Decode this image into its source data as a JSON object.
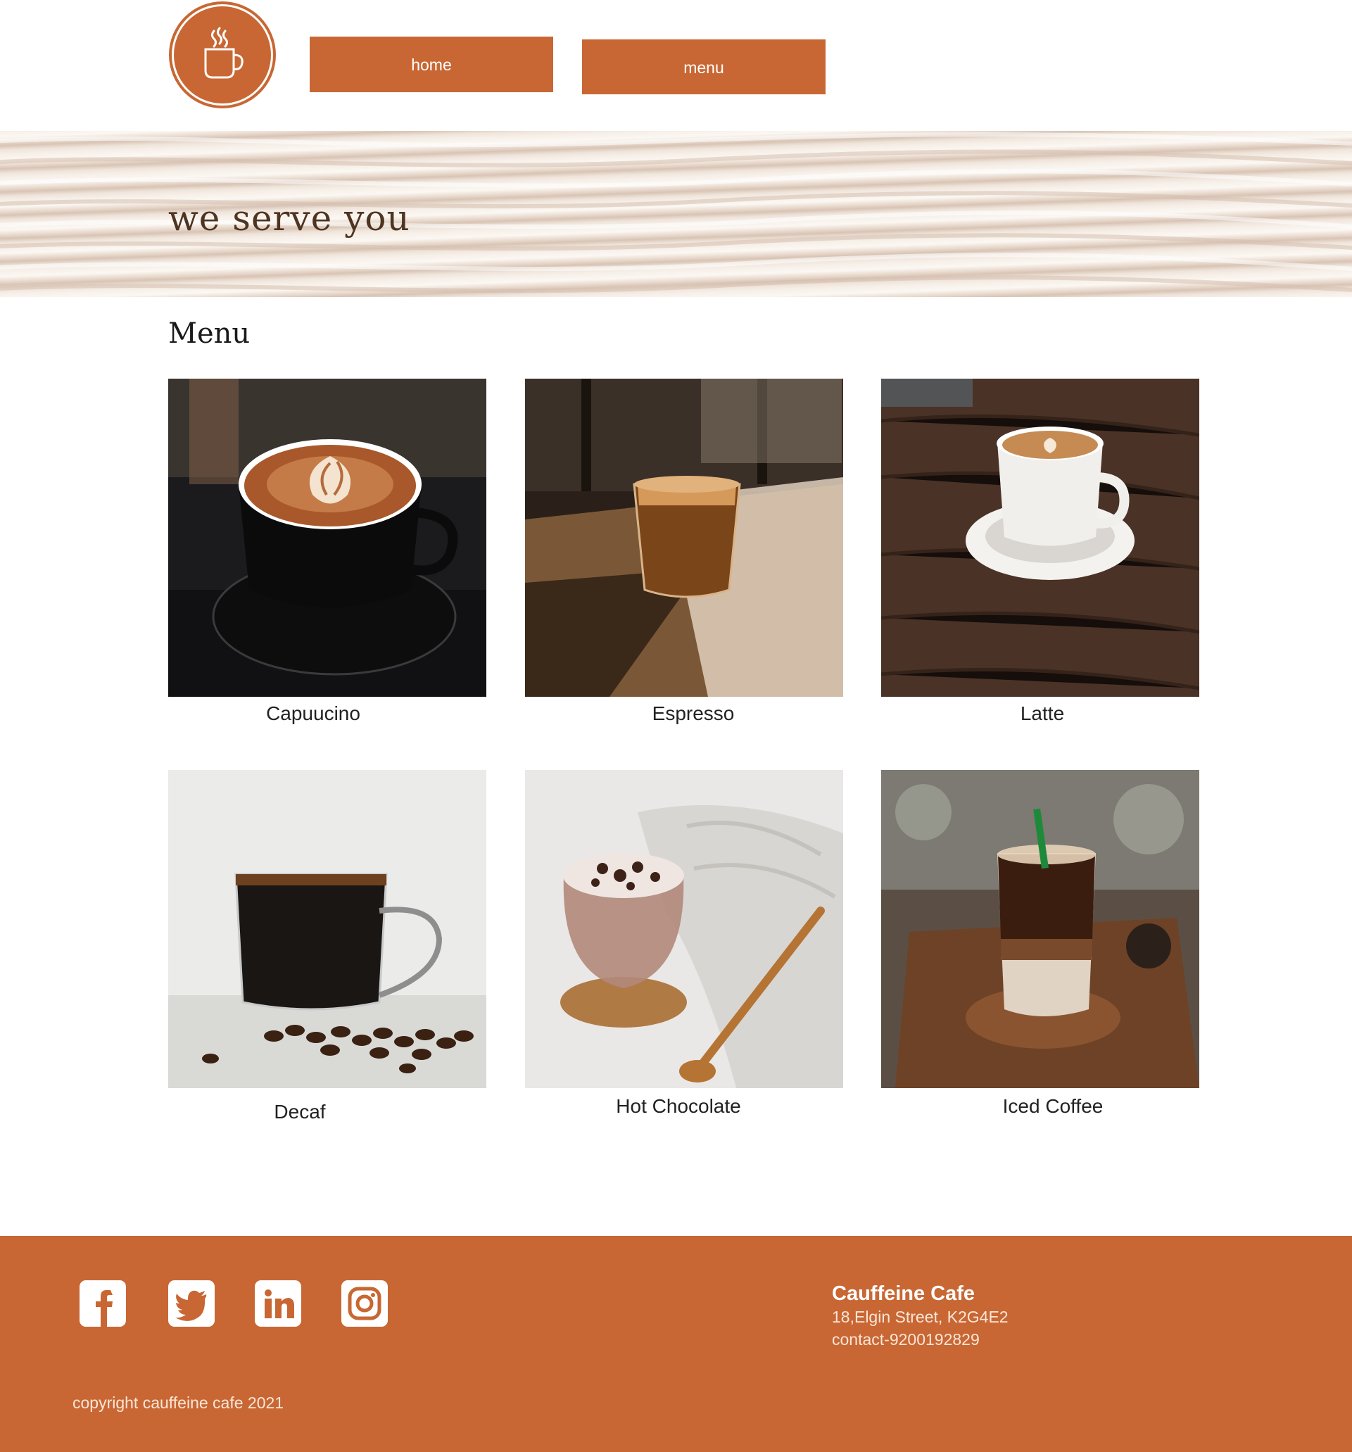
{
  "header": {
    "logo_icon": "coffee-cup-icon",
    "nav": [
      {
        "label": "home"
      },
      {
        "label": "menu"
      }
    ]
  },
  "hero": {
    "title": "we serve you"
  },
  "menu": {
    "heading": "Menu",
    "items": [
      {
        "name": "Capuucino",
        "image": "cappuccino-photo"
      },
      {
        "name": "Espresso",
        "image": "espresso-photo"
      },
      {
        "name": "Latte",
        "image": "latte-photo"
      },
      {
        "name": "Decaf",
        "image": "decaf-photo"
      },
      {
        "name": "Hot Chocolate",
        "image": "hot-chocolate-photo"
      },
      {
        "name": "Iced Coffee",
        "image": "iced-coffee-photo"
      }
    ]
  },
  "footer": {
    "social": [
      "facebook-icon",
      "twitter-icon",
      "linkedin-icon",
      "instagram-icon"
    ],
    "cafe_name": "Cauffeine Cafe",
    "address": "18,Elgin Street, K2G4E2",
    "contact": "contact-9200192829",
    "copyright": "copyright cauffeine cafe 2021"
  },
  "colors": {
    "accent": "#c86733",
    "hero_text": "#4e3421"
  }
}
